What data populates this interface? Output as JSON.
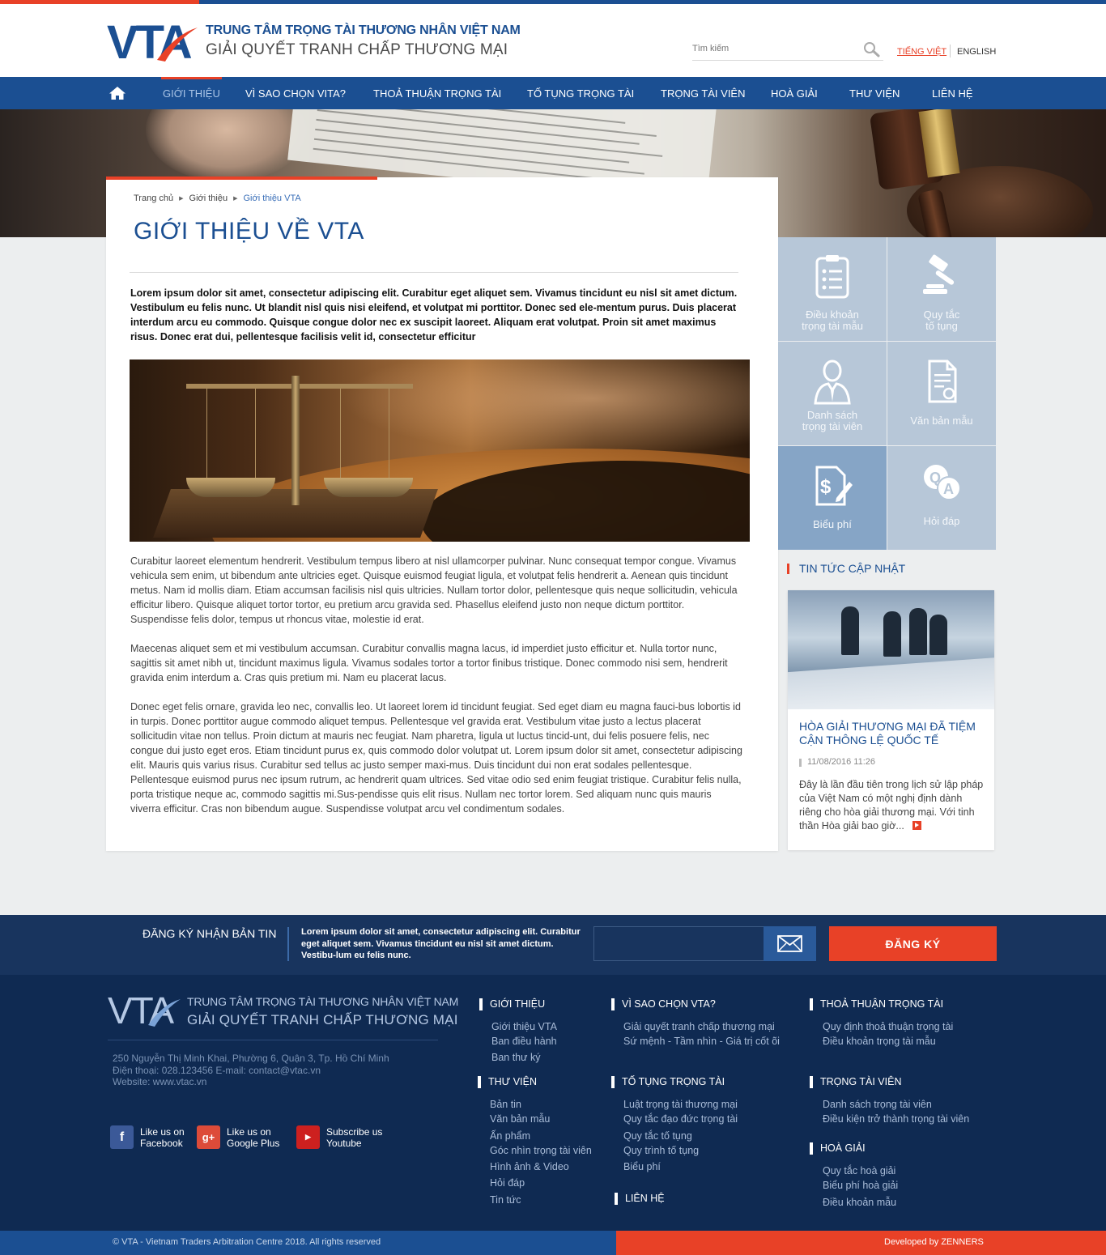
{
  "header": {
    "logo_text": "VTA",
    "org_name": "TRUNG TÂM TRỌNG TÀI THƯƠNG NHÂN VIỆT NAM",
    "tagline": "GIẢI QUYẾT TRANH CHẤP THƯƠNG MẠI",
    "search_placeholder": "Tìm kiếm",
    "lang_vi": "TIẾNG VIỆT",
    "lang_en": "ENGLISH"
  },
  "nav": {
    "home_icon": "home-icon",
    "items": [
      "GIỚI THIỆU",
      "VÌ SAO CHỌN VITA?",
      "THOẢ THUẬN TRỌNG TÀI",
      "TỐ TỤNG TRỌNG TÀI",
      "TRỌNG TÀI VIÊN",
      "HOÀ GIẢI",
      "THƯ VIỆN",
      "LIÊN HỆ"
    ],
    "active_index": 0
  },
  "breadcrumb": [
    "Trang chủ",
    "Giới thiệu",
    "Giới thiệu VTA"
  ],
  "page": {
    "title": "GIỚI THIỆU VỀ VTA",
    "lead": "Lorem ipsum dolor sit amet, consectetur adipiscing elit. Curabitur eget aliquet sem. Vivamus tincidunt eu nisl sit amet dictum. Vestibulum eu felis nunc. Ut blandit nisl quis nisi eleifend, et volutpat mi porttitor. Donec sed ele-mentum purus. Duis placerat interdum arcu eu commodo. Quisque congue dolor nec ex suscipit laoreet. Aliquam erat volutpat. Proin sit amet maximus risus. Donec erat dui, pellentesque facilisis velit id, consectetur efficitur",
    "paragraphs": [
      "Curabitur laoreet elementum hendrerit. Vestibulum tempus libero at nisl ullamcorper pulvinar. Nunc consequat tempor congue. Vivamus vehicula sem enim, ut bibendum ante ultricies eget. Quisque euismod feugiat ligula, et volutpat felis hendrerit a. Aenean quis tincidunt metus. Nam id mollis diam. Etiam accumsan facilisis nisl quis ultricies. Nullam tortor dolor, pellentesque quis neque sollicitudin, vehicula efficitur libero. Quisque aliquet tortor tortor, eu pretium arcu gravida sed. Phasellus eleifend justo non neque dictum porttitor. Suspendisse felis dolor, tempus ut rhoncus vitae, molestie id erat.",
      "Maecenas aliquet sem et mi vestibulum accumsan. Curabitur convallis magna lacus, id imperdiet justo efficitur et. Nulla tortor nunc, sagittis sit amet nibh ut, tincidunt maximus ligula. Vivamus sodales tortor a tortor finibus tristique. Donec commodo nisi sem, hendrerit gravida enim interdum a. Cras quis pretium mi. Nam eu placerat lacus.",
      "Donec eget felis ornare, gravida leo nec, convallis leo. Ut laoreet lorem id tincidunt feugiat. Sed eget diam eu magna fauci-bus lobortis id in turpis. Donec porttitor augue commodo aliquet tempus. Pellentesque vel gravida erat. Vestibulum vitae justo a lectus placerat sollicitudin vitae non tellus. Proin dictum at mauris nec feugiat. Nam pharetra, ligula ut luctus tincid-unt, dui felis posuere felis, nec congue dui justo eget eros. Etiam tincidunt purus ex, quis commodo dolor volutpat ut. Lorem ipsum dolor sit amet, consectetur adipiscing elit. Mauris quis varius risus. Curabitur sed tellus ac justo semper maxi-mus. Duis tincidunt dui non erat sodales pellentesque. Pellentesque euismod purus nec ipsum rutrum, ac hendrerit quam ultrices. Sed vitae odio sed enim feugiat tristique. Curabitur felis nulla, porta tristique neque ac, commodo sagittis mi.Sus-pendisse quis elit risus. Nullam nec tortor lorem. Sed aliquam nunc quis mauris viverra efficitur. Cras non bibendum augue. Suspendisse volutpat arcu vel condimentum sodales."
    ]
  },
  "tiles": [
    {
      "label1": "Điều khoản",
      "label2": "trọng tài mẫu",
      "icon": "clipboard-icon"
    },
    {
      "label1": "Quy tắc",
      "label2": "tố tụng",
      "icon": "gavel-icon"
    },
    {
      "label1": "Danh sách",
      "label2": "trọng tài viên",
      "icon": "person-icon"
    },
    {
      "label1": "Văn bản mẫu",
      "label2": "",
      "icon": "certificate-doc-icon"
    },
    {
      "label1": "Biểu phí",
      "label2": "",
      "icon": "fee-doc-icon"
    },
    {
      "label1": "Hỏi đáp",
      "label2": "",
      "icon": "qa-icon"
    }
  ],
  "news": {
    "heading": "TIN TỨC CẬP NHẬT",
    "title": "HÒA GIẢI THƯƠNG MẠI ĐÃ TIỆM CẬN THÔNG LỆ QUỐC TẾ",
    "date": "11/08/2016 11:26",
    "excerpt": "Đây là lần đầu tiên trong lịch sử lập pháp của Việt Nam có một nghị định dành riêng cho hòa giải thương mại. Với tinh thần Hòa giải bao giờ..."
  },
  "newsletter": {
    "label": "ĐĂNG KÝ NHẬN BẢN TIN",
    "text": "Lorem ipsum dolor sit amet, consectetur adipiscing elit. Curabitur eget aliquet sem. Vivamus tincidunt eu nisl sit amet dictum. Vestibu-lum eu felis nunc.",
    "button": "ĐĂNG KÝ"
  },
  "footer": {
    "logo_text": "VTA",
    "org_name": "TRUNG TÂM TRỌNG TÀI THƯƠNG NHÂN VIỆT NAM",
    "tagline": "GIẢI QUYẾT TRANH CHẤP THƯƠNG MẠI",
    "address": "250 Nguyễn Thị Minh Khai, Phường 6, Quận 3, Tp. Hồ Chí Minh",
    "contact": "Điện thoại: 028.123456 E-mail: contact@vtac.vn",
    "website": "Website: www.vtac.vn",
    "social": [
      {
        "line1": "Like us on",
        "line2": "Facebook",
        "icon": "facebook-icon",
        "color": "#3b5998"
      },
      {
        "line1": "Like us on",
        "line2": "Google Plus",
        "icon": "google-plus-icon",
        "color": "#dd4b39"
      },
      {
        "line1": "Subscribe us",
        "line2": "Youtube",
        "icon": "youtube-icon",
        "color": "#cd201f"
      }
    ],
    "columns": {
      "gioi_thieu": {
        "head": "GIỚI THIỆU",
        "links": [
          "Giới thiệu VTA",
          "Ban điều hành",
          "Ban thư ký"
        ]
      },
      "vi_sao": {
        "head": "VÌ SAO CHỌN VTA?",
        "links": [
          "Giải quyết tranh chấp thương mại",
          "Sứ mệnh - Tầm  nhìn - Giá trị cốt õi"
        ]
      },
      "thoa_thuan": {
        "head": "THOẢ THUẬN TRỌNG TÀI",
        "links": [
          "Quy định thoả thuận trọng tài",
          "Điều khoản trọng tài mẫu"
        ]
      },
      "thu_vien": {
        "head": "THƯ VIỆN",
        "links": [
          "Bản tin",
          "Văn bản mẫu",
          "Ấn phẩm",
          "Góc nhìn trọng tài viên",
          "Hình ảnh & Video",
          "Hỏi đáp",
          "Tin tức"
        ]
      },
      "to_tung": {
        "head": "TỐ TỤNG TRỌNG TÀI",
        "links": [
          "Luật trọng tài thương mại",
          "Quy tắc đạo đức trọng tài",
          "Quy tắc tố tụng",
          "Quy trình tố tụng",
          "Biểu phí"
        ]
      },
      "trong_tai_vien": {
        "head": "TRỌNG TÀI VIÊN",
        "links": [
          "Danh sách trọng tài viên",
          "Điều kiện trở thành trọng tài viên"
        ]
      },
      "hoa_giai": {
        "head": "HOÀ GIẢI",
        "links": [
          "Quy tắc hoà giải",
          "Biểu phí hoà giải",
          "Điều khoản mẫu"
        ]
      },
      "lien_he": {
        "head": "LIÊN HỆ",
        "links": []
      }
    },
    "copyright": "© VTA - Vietnam Traders Arbitration Centre  2018. All rights reserved",
    "developer": "Developed by ZENNERS"
  },
  "colors": {
    "brand_blue": "#1b4f92",
    "accent_red": "#e84127",
    "footer_navy": "#0f2a52"
  }
}
